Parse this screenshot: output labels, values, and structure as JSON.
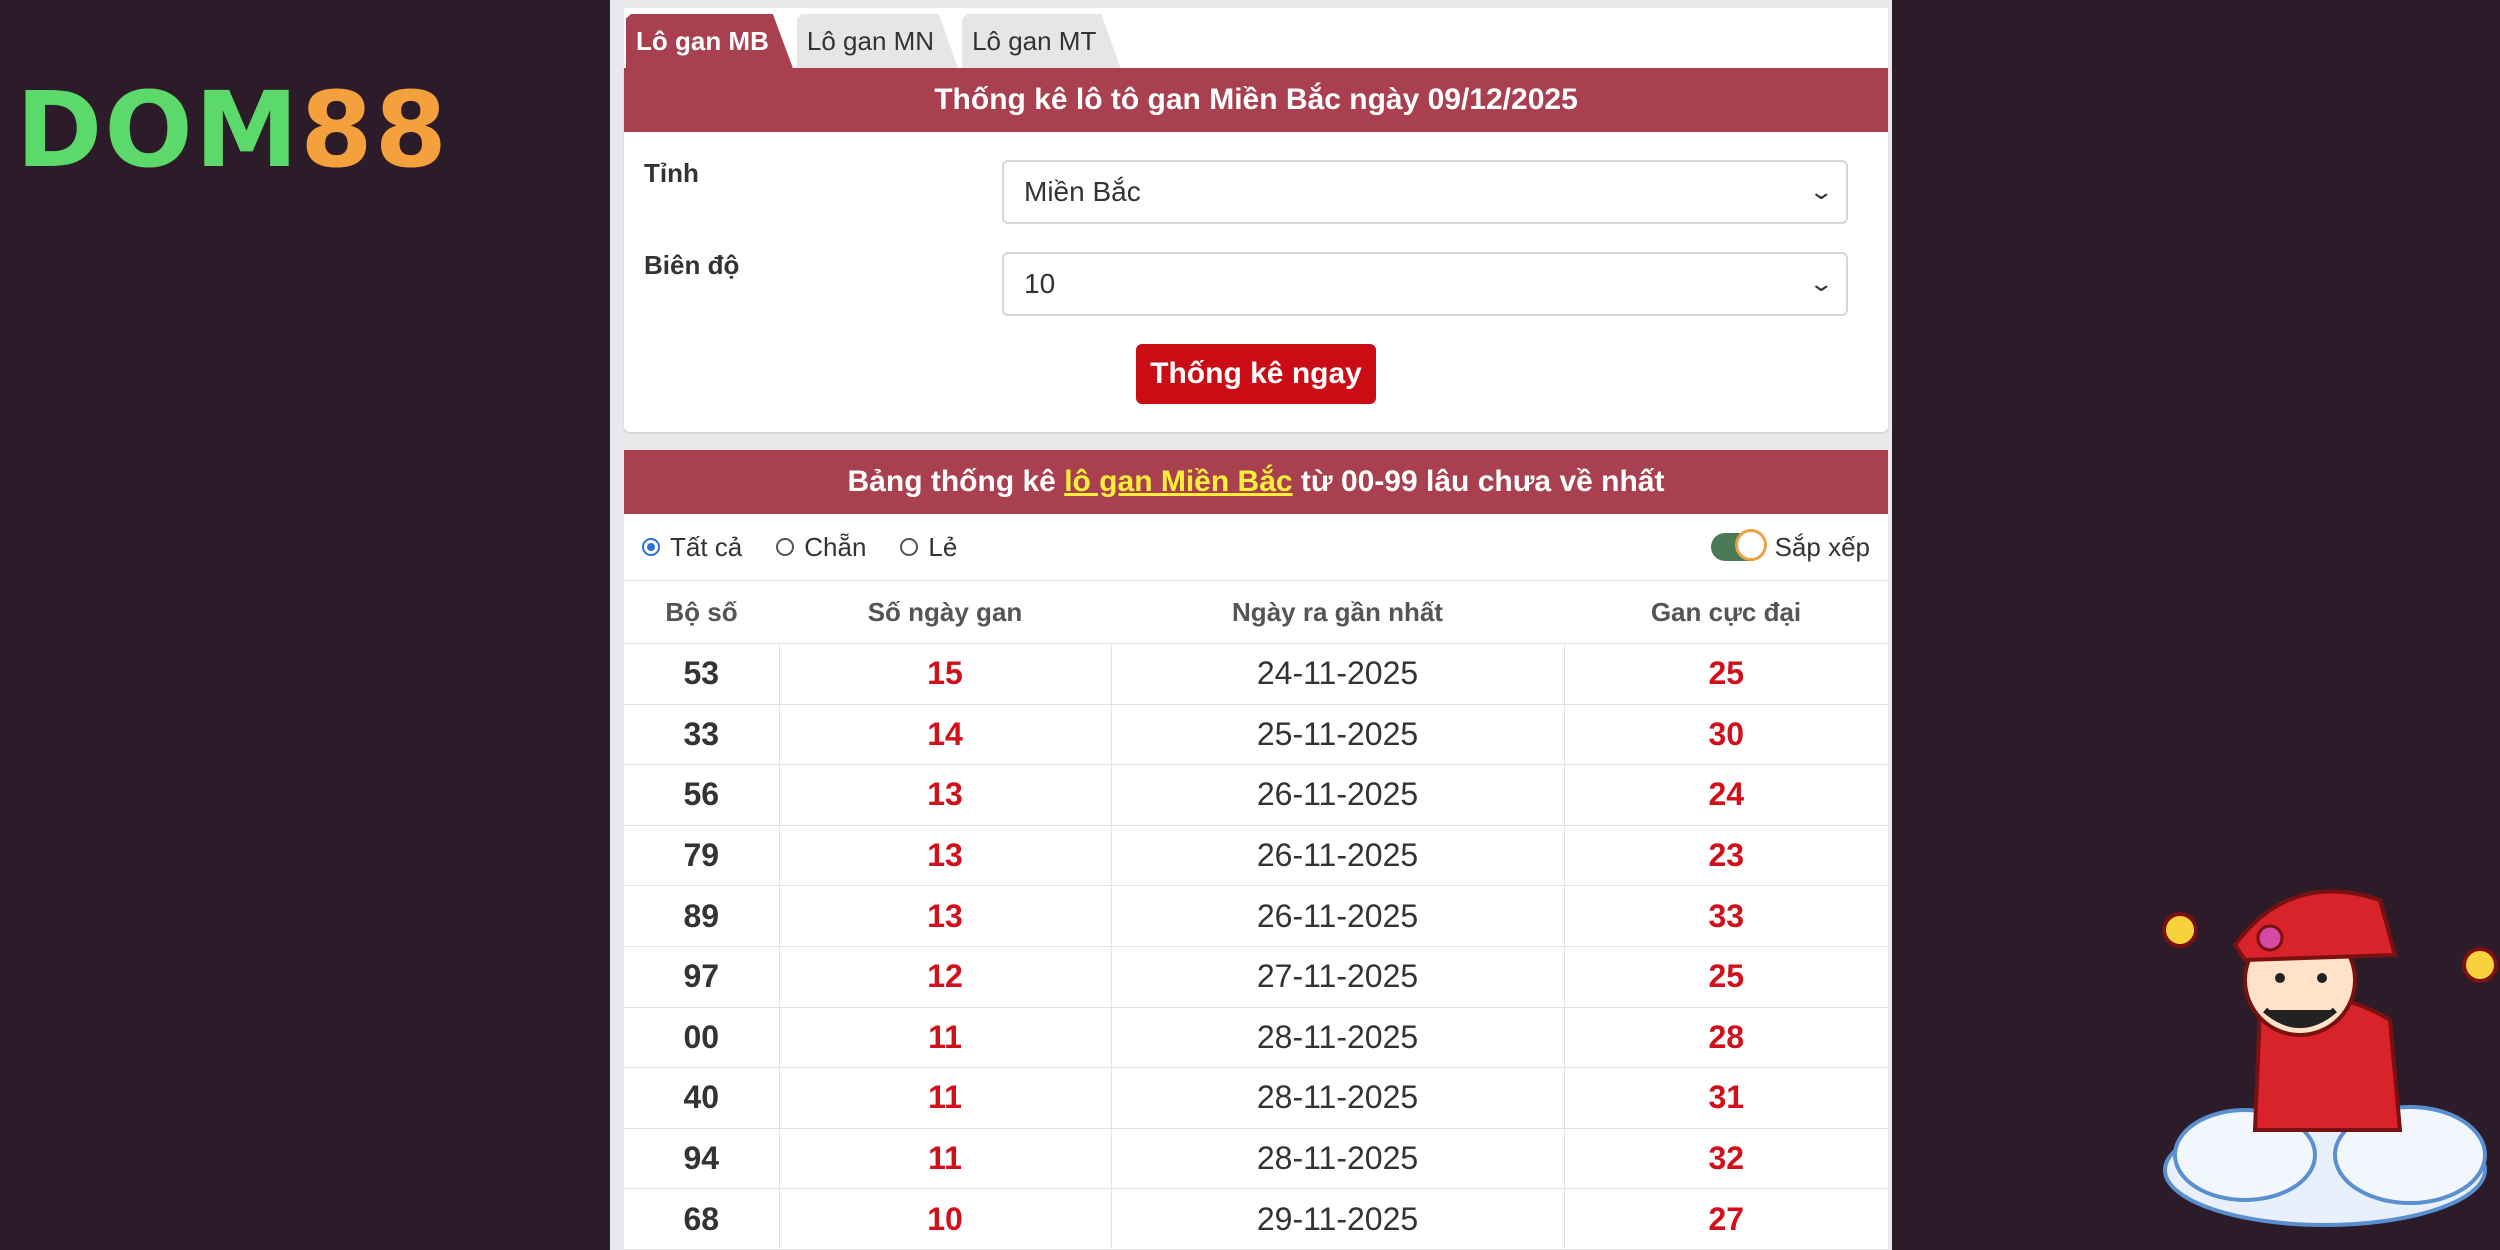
{
  "brand": {
    "part1": "DOM",
    "part2": "88"
  },
  "tabs": [
    {
      "label": "Lô gan MB"
    },
    {
      "label": "Lô gan MN"
    },
    {
      "label": "Lô gan MT"
    }
  ],
  "form": {
    "title": "Thống kê lô tô gan Miền Bắc ngày 09/12/2025",
    "province_label": "Tỉnh",
    "province_value": "Miền Bắc",
    "range_label": "Biên độ",
    "range_value": "10",
    "submit_label": "Thống kê ngay"
  },
  "results": {
    "title_prefix": "Bảng thống kê ",
    "title_link": "lô gan Miền Bắc",
    "title_suffix": " từ 00-99 lâu chưa về nhất",
    "filters": [
      "Tất cả",
      "Chẵn",
      "Lẻ"
    ],
    "sort_label": "Sắp xếp",
    "columns": [
      "Bộ số",
      "Số ngày gan",
      "Ngày ra gần nhất",
      "Gan cực đại"
    ],
    "rows": [
      [
        "53",
        "15",
        "24-11-2025",
        "25"
      ],
      [
        "33",
        "14",
        "25-11-2025",
        "30"
      ],
      [
        "56",
        "13",
        "26-11-2025",
        "24"
      ],
      [
        "79",
        "13",
        "26-11-2025",
        "23"
      ],
      [
        "89",
        "13",
        "26-11-2025",
        "33"
      ],
      [
        "97",
        "12",
        "27-11-2025",
        "25"
      ],
      [
        "00",
        "11",
        "28-11-2025",
        "28"
      ],
      [
        "40",
        "11",
        "28-11-2025",
        "31"
      ],
      [
        "94",
        "11",
        "28-11-2025",
        "32"
      ],
      [
        "68",
        "10",
        "29-11-2025",
        "27"
      ]
    ]
  },
  "colors": {
    "header": "#a8404f",
    "button": "#cc0c14",
    "highlight": "#ffef3a",
    "value_red": "#d0101a"
  }
}
